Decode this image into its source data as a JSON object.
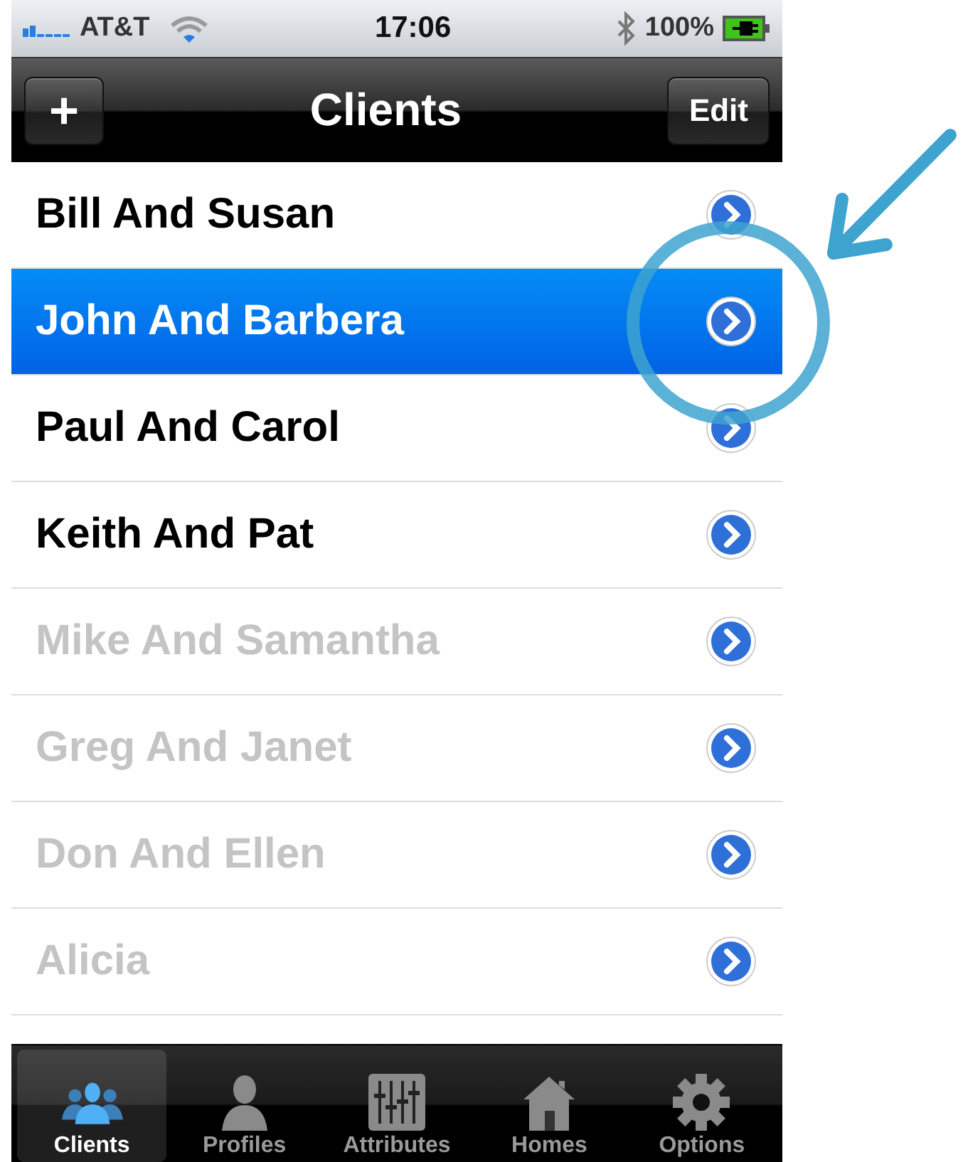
{
  "status_bar": {
    "carrier": "AT&T",
    "time": "17:06",
    "battery": "100%"
  },
  "nav_bar": {
    "left_button": "+",
    "title": "Clients",
    "right_button": "Edit"
  },
  "clients": [
    {
      "name": "Bill And Susan",
      "selected": false,
      "disabled": false
    },
    {
      "name": "John And Barbera",
      "selected": true,
      "disabled": false
    },
    {
      "name": "Paul And Carol",
      "selected": false,
      "disabled": false
    },
    {
      "name": "Keith And Pat",
      "selected": false,
      "disabled": false
    },
    {
      "name": "Mike And Samantha",
      "selected": false,
      "disabled": true
    },
    {
      "name": "Greg And Janet",
      "selected": false,
      "disabled": true
    },
    {
      "name": "Don And Ellen",
      "selected": false,
      "disabled": true
    },
    {
      "name": "Alicia",
      "selected": false,
      "disabled": true
    }
  ],
  "tab_bar": [
    {
      "label": "Clients",
      "kind": "people",
      "selected": true
    },
    {
      "label": "Profiles",
      "kind": "person",
      "selected": false
    },
    {
      "label": "Attributes",
      "kind": "sliders",
      "selected": false
    },
    {
      "label": "Homes",
      "kind": "house",
      "selected": false
    },
    {
      "label": "Options",
      "kind": "gear",
      "selected": false
    }
  ]
}
